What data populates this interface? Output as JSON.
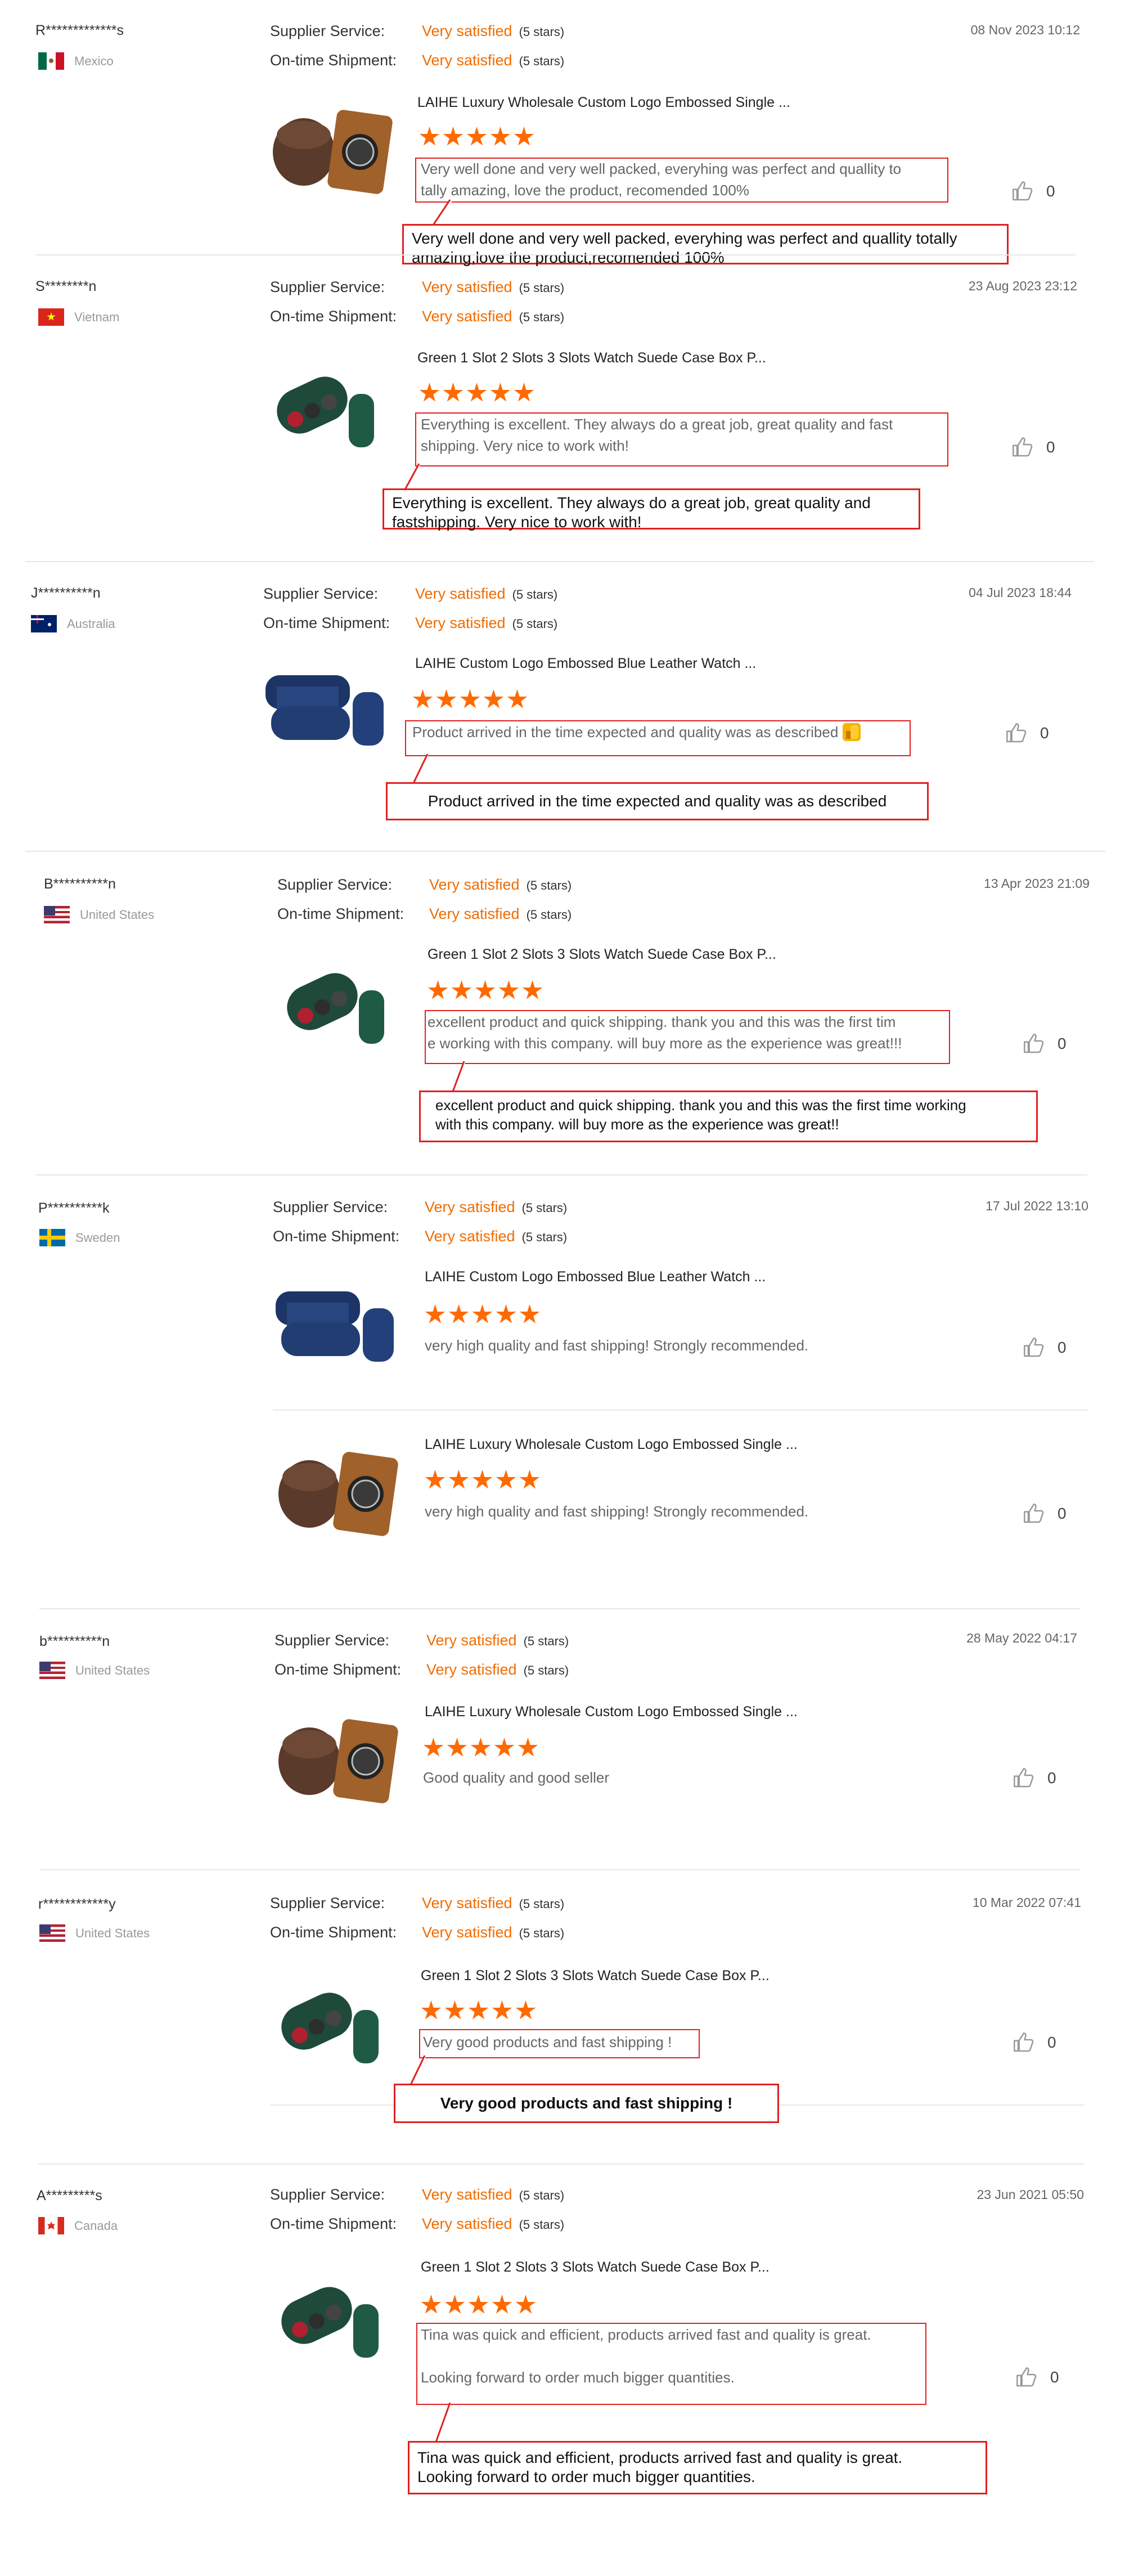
{
  "labels": {
    "supplier_service": "Supplier Service:",
    "ontime_shipment": "On-time Shipment:",
    "rating_value": "Very satisfied",
    "rating_stars": "(5 stars)"
  },
  "reviews": [
    {
      "user": "R*************s",
      "country": "Mexico",
      "date": "08 Nov 2023 10:12",
      "product": "LAIHE Luxury Wholesale Custom Logo Embossed Single ...",
      "text_line1": "Very well done and very well packed, everyhing was perfect and quallity to",
      "text_line2": "tally amazing, love the product, recomended 100%",
      "callout_line1": "Very well done and very well packed, everyhing was perfect and quallity totally",
      "callout_line2": "amazing,love the product,recomended 100%",
      "likes": "0"
    },
    {
      "user": "S********n",
      "country": "Vietnam",
      "date": "23 Aug 2023 23:12",
      "product": "Green 1 Slot 2 Slots 3 Slots Watch Suede Case Box P...",
      "text_line1": "Everything is excellent.  They always do a great job, great quality and fast",
      "text_line2": "shipping.  Very nice to work with!",
      "callout_line1": "Everything is excellent. They always do a great job, great quality and",
      "callout_line2": "fastshipping. Very nice to work with!",
      "likes": "0"
    },
    {
      "user": "J**********n",
      "country": "Australia",
      "date": "04 Jul 2023 18:44",
      "product": "LAIHE Custom Logo Embossed Blue Leather Watch ...",
      "text_line1": "Product arrived in the time expected and quality was as described",
      "callout_line1": "Product arrived in the time expected and quality was as described",
      "likes": "0"
    },
    {
      "user": "B**********n",
      "country": "United States",
      "date": "13 Apr 2023 21:09",
      "product": "Green 1 Slot 2 Slots 3 Slots Watch Suede Case Box P...",
      "text_line1": "excellent product and quick shipping. thank you and this was the first tim",
      "text_line2": "e working with this company. will buy more as the experience was great!!!",
      "callout_line1": "excellent product and quick shipping. thank you and this was the first time working",
      "callout_line2": "with this company. will buy more as the experience was great!!",
      "likes": "0"
    },
    {
      "user": "P**********k",
      "country": "Sweden",
      "date": "17 Jul 2022 13:10",
      "product": "LAIHE Custom Logo Embossed Blue Leather Watch ...",
      "text_line1": "very high quality and fast shipping! Strongly recommended.",
      "product2": "LAIHE Luxury Wholesale Custom Logo Embossed Single ...",
      "text2_line1": "very high quality and fast shipping! Strongly recommended.",
      "likes": "0",
      "likes2": "0"
    },
    {
      "user": "b**********n",
      "country": "United States",
      "date": "28 May 2022 04:17",
      "product": "LAIHE Luxury Wholesale Custom Logo Embossed Single ...",
      "text_line1": "Good quality and good seller",
      "likes": "0"
    },
    {
      "user": "r************y",
      "country": "United States",
      "date": "10 Mar 2022 07:41",
      "product": "Green 1 Slot 2 Slots 3 Slots Watch Suede Case Box P...",
      "text_line1": "Very good products and fast shipping !",
      "callout_line1": "Very good products and fast shipping !",
      "likes": "0"
    },
    {
      "user": "A*********s",
      "country": "Canada",
      "date": "23 Jun 2021 05:50",
      "product": "Green 1 Slot 2 Slots 3 Slots Watch Suede Case Box P...",
      "text_line1": "Tina was quick and efficient, products arrived fast and quality is great.",
      "text_line2": "Looking forward to order much bigger quantities.",
      "callout_line1": "Tina was quick and efficient, products arrived fast and quality is great.",
      "callout_line2": "Looking forward to order much bigger quantities.",
      "likes": "0"
    }
  ],
  "colors": {
    "accent": "#f06c00",
    "star": "#ff6a00",
    "highlight": "#e02020"
  },
  "icons": {
    "like": "thumbs-up-icon",
    "flag": "country-flag-icon",
    "thumb": "product-thumbnail"
  }
}
